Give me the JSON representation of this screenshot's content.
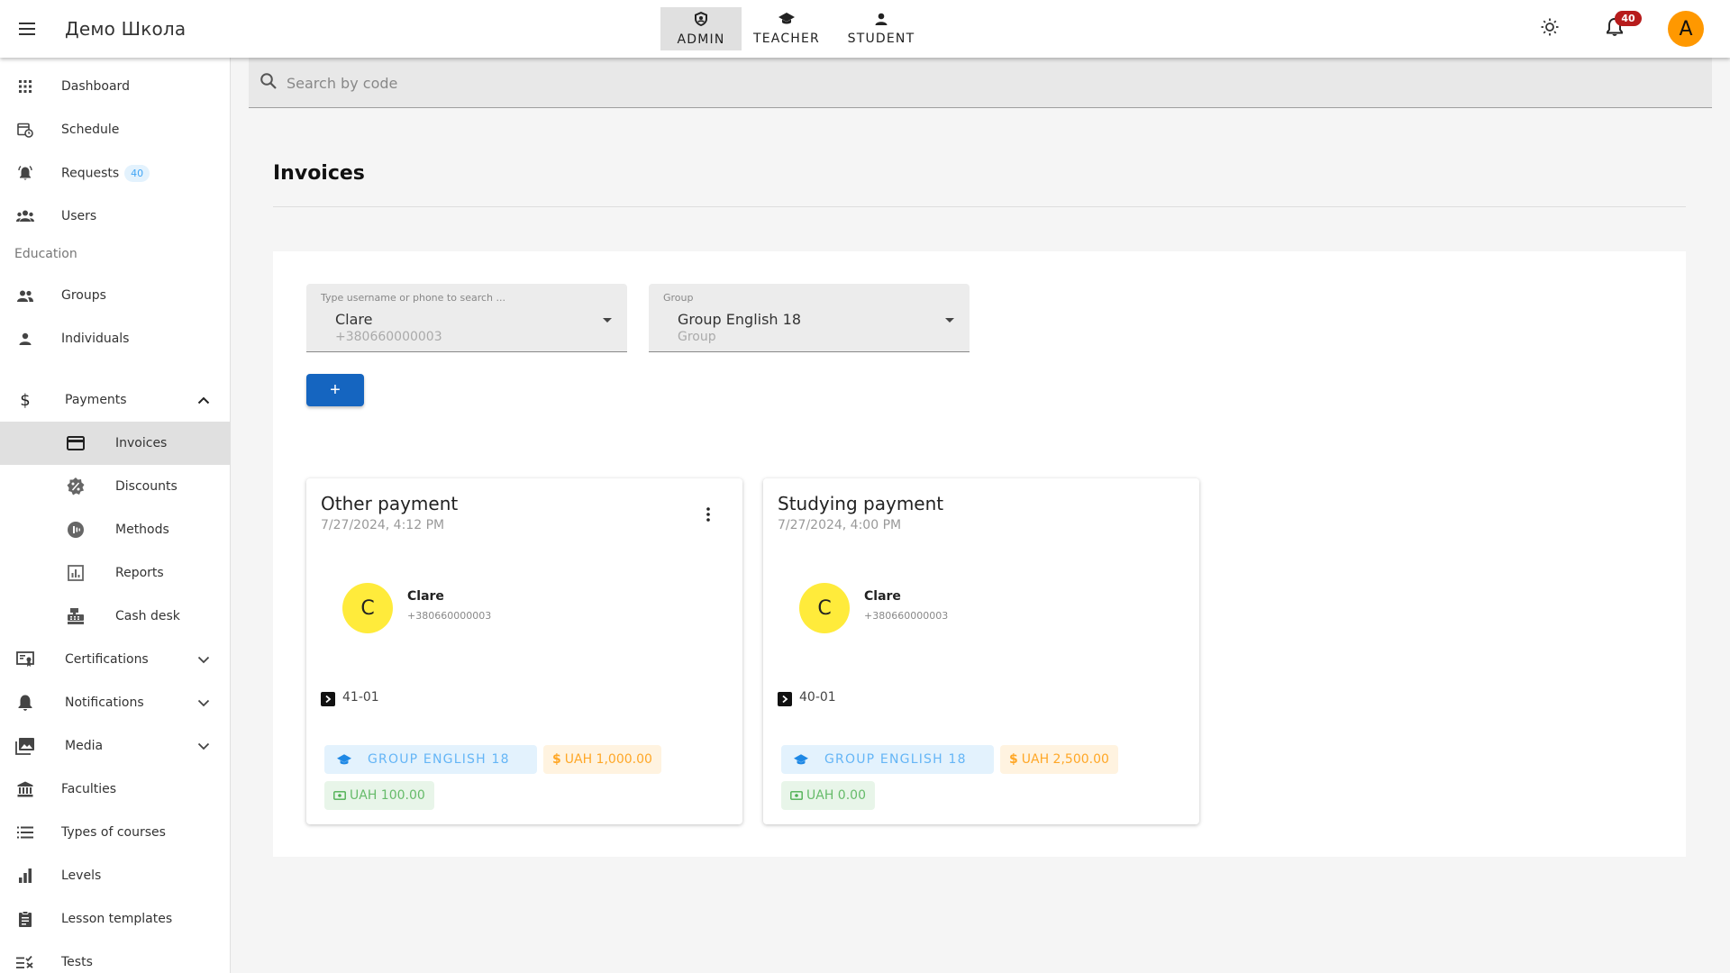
{
  "app": {
    "title": "Демо Школа"
  },
  "roles": [
    {
      "label": "ADMIN",
      "icon": "shield-icon",
      "active": true
    },
    {
      "label": "TEACHER",
      "icon": "graduation-cap-icon",
      "active": false
    },
    {
      "label": "STUDENT",
      "icon": "person-icon",
      "active": false
    }
  ],
  "topbar": {
    "notifications_count": "40",
    "avatar_letter": "A"
  },
  "sidebar": {
    "items": [
      {
        "label": "Dashboard",
        "icon": "apps-grid-icon"
      },
      {
        "label": "Schedule",
        "icon": "calendar-clock-icon"
      },
      {
        "label": "Requests",
        "icon": "bell-ring-icon",
        "badge": "40"
      },
      {
        "label": "Users",
        "icon": "users-icon"
      }
    ],
    "section_education": "Education",
    "education": [
      {
        "label": "Groups",
        "icon": "group-icon"
      },
      {
        "label": "Individuals",
        "icon": "person-icon"
      }
    ],
    "payments": {
      "label": "Payments",
      "icon": "dollar-icon",
      "children": [
        {
          "label": "Invoices",
          "icon": "credit-card-icon",
          "active": true
        },
        {
          "label": "Discounts",
          "icon": "discount-badge-icon"
        },
        {
          "label": "Methods",
          "icon": "payment-method-icon"
        },
        {
          "label": "Reports",
          "icon": "report-chart-icon"
        },
        {
          "label": "Cash desk",
          "icon": "cash-register-icon"
        }
      ]
    },
    "collapsibles": [
      {
        "label": "Certifications",
        "icon": "certificate-icon"
      },
      {
        "label": "Notifications",
        "icon": "bell-icon"
      },
      {
        "label": "Media",
        "icon": "images-icon"
      }
    ],
    "more": [
      {
        "label": "Faculties",
        "icon": "institution-icon"
      },
      {
        "label": "Types of courses",
        "icon": "list-icon"
      },
      {
        "label": "Levels",
        "icon": "bar-chart-icon"
      },
      {
        "label": "Lesson templates",
        "icon": "clipboard-icon"
      },
      {
        "label": "Tests",
        "icon": "checklist-icon"
      }
    ]
  },
  "search": {
    "placeholder": "Search by code"
  },
  "page": {
    "title": "Invoices"
  },
  "filters": {
    "user": {
      "label": "Type username or phone to search ...",
      "value": "Clare",
      "sub": "+380660000003"
    },
    "group": {
      "label": "Group",
      "value": "Group English 18",
      "sub": "Group"
    }
  },
  "add_button": {
    "label": "+"
  },
  "invoices": [
    {
      "title": "Other payment",
      "date": "7/27/2024, 4:12 PM",
      "user": {
        "initial": "C",
        "name": "Clare",
        "phone": "+380660000003"
      },
      "code": "41-01",
      "group": "GROUP ENGLISH 18",
      "amount": "UAH 1,000.00",
      "discount": "UAH 100.00",
      "has_menu": true
    },
    {
      "title": "Studying payment",
      "date": "7/27/2024, 4:00 PM",
      "user": {
        "initial": "C",
        "name": "Clare",
        "phone": "+380660000003"
      },
      "code": "40-01",
      "group": "GROUP ENGLISH 18",
      "amount": "UAH 2,500.00",
      "discount": "UAH 0.00",
      "has_menu": false
    }
  ],
  "colors": {
    "primary": "#1565c0",
    "avatar_top": "#ff9800",
    "user_avatar": "#ffeb3b",
    "badge_red": "#b71c1c"
  }
}
